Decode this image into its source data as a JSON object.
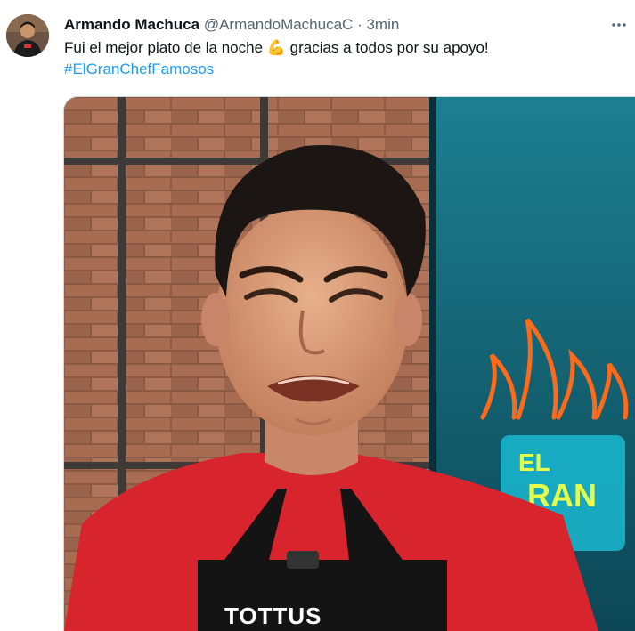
{
  "tweet": {
    "author_name": "Armando Machuca",
    "author_handle": "@ArmandoMachucaC",
    "separator": "·",
    "time": "3min",
    "text": "Fui el mejor plato de la noche 💪 gracias a todos por su apoyo!",
    "hashtag": "#ElGranChefFamosos"
  },
  "media": {
    "apron_text": "TOTTUS",
    "sign_letters": "EL GRAN"
  },
  "icons": {
    "more": "more-icon",
    "avatar": "avatar"
  },
  "colors": {
    "hashtag": "#1d9bf0",
    "secondary_text": "#536471",
    "shirt": "#d8242c",
    "apron": "#141414"
  }
}
